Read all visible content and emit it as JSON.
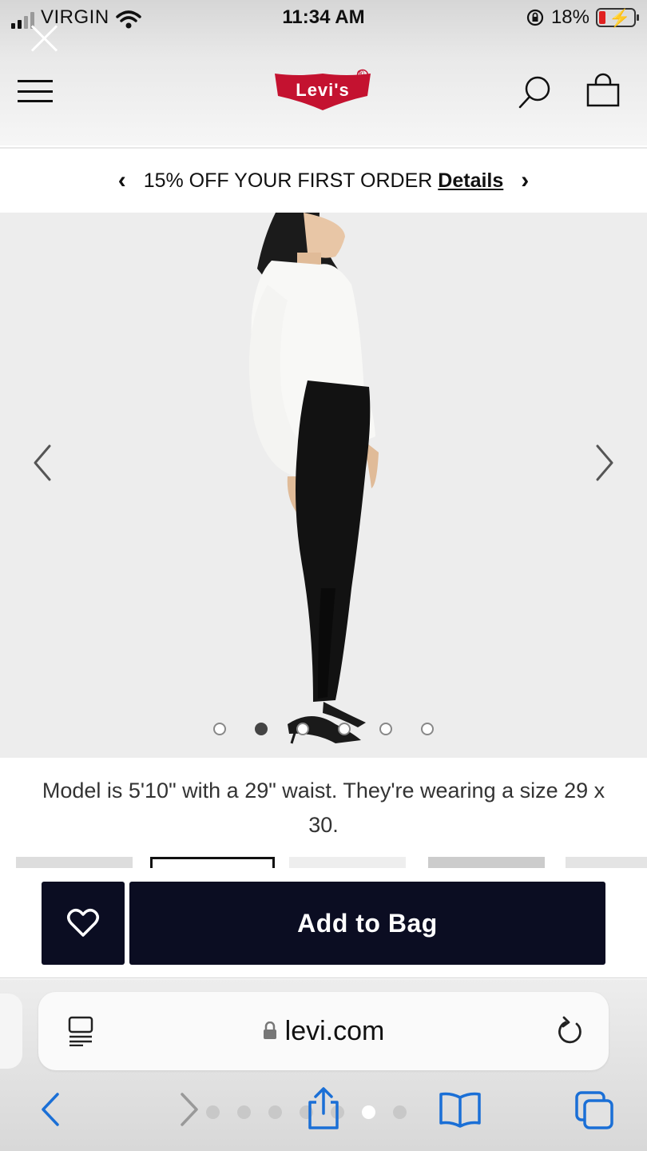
{
  "status_bar": {
    "carrier": "VIRGIN",
    "time": "11:34 AM",
    "battery": "18%"
  },
  "header": {
    "logo_text": "Levi's",
    "logo_mark": "®"
  },
  "promo": {
    "text": "15% OFF YOUR FIRST ORDER",
    "link": "Details"
  },
  "hero": {
    "slide_count": 6,
    "active_slide_index": 2
  },
  "product": {
    "model_info": "Model is 5'10\" with a 29\" waist. They're wearing a size 29 x 30."
  },
  "actions": {
    "add_to_bag": "Add to Bag"
  },
  "browser": {
    "url": "levi.com"
  },
  "colors": {
    "brand_red": "#c41230",
    "button_navy": "#0b0d22",
    "safari_blue": "#1a6fd6"
  }
}
